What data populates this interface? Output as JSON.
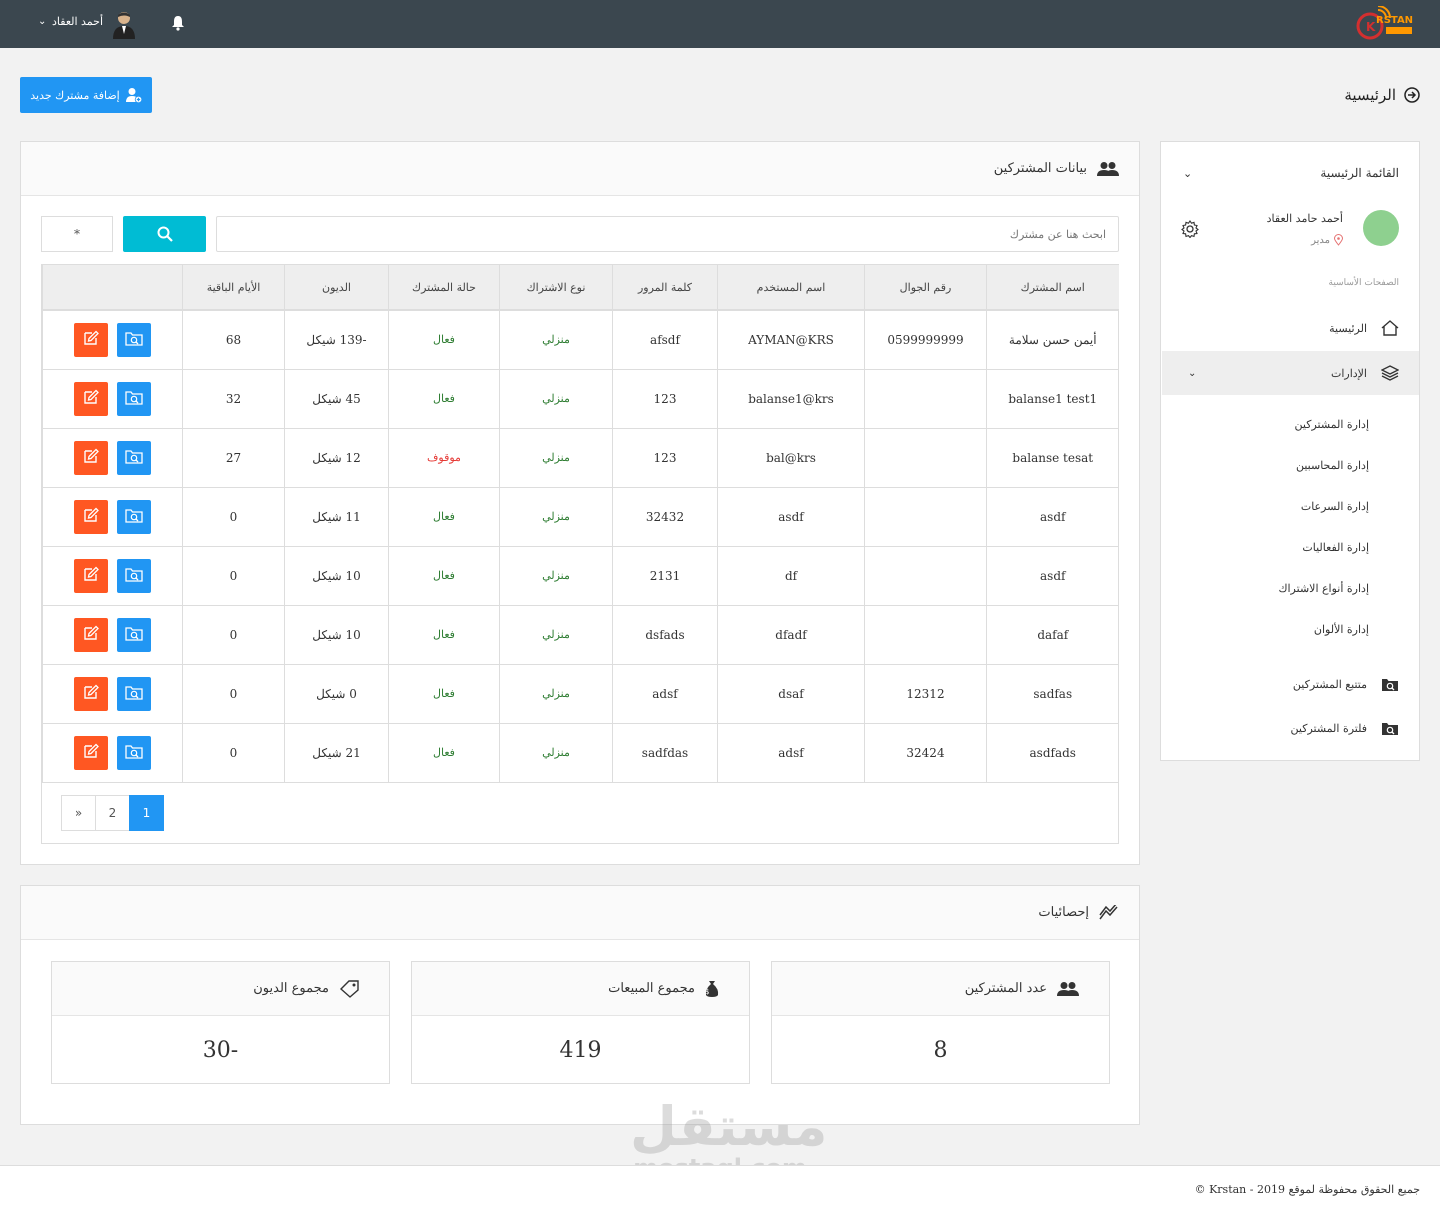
{
  "header": {
    "logo_text": "KRSTAN",
    "user_name": "أحمد العقاد"
  },
  "page": {
    "breadcrumb": "الرئيسية",
    "add_button": "إضافة مشترك جديد"
  },
  "subscribers": {
    "title": "بيانات المشتركين",
    "search_placeholder": "ابحث هنا عن مشترك",
    "star": "*",
    "columns": [
      "اسم المشترك",
      "رقم الجوال",
      "اسم المستخدم",
      "كلمة المرور",
      "نوع الاشتراك",
      "حالة المشترك",
      "الديون",
      "الأيام الباقية",
      ""
    ],
    "rows": [
      {
        "name": "أيمن حسن سلامة",
        "mobile": "0599999999",
        "username": "AYMAN@KRS",
        "password": "afsdf",
        "type": "منزلي",
        "status": "فعال",
        "debt": "-139 شيكل",
        "days": "68"
      },
      {
        "name": "balanse1 test1",
        "mobile": "",
        "username": "balanse1@krs",
        "password": "123",
        "type": "منزلي",
        "status": "فعال",
        "debt": "45 شيكل",
        "days": "32"
      },
      {
        "name": "balanse tesat",
        "mobile": "",
        "username": "bal@krs",
        "password": "123",
        "type": "منزلي",
        "status": "موقوف",
        "debt": "12 شيكل",
        "days": "27"
      },
      {
        "name": "asdf",
        "mobile": "",
        "username": "asdf",
        "password": "32432",
        "type": "منزلي",
        "status": "فعال",
        "debt": "11 شيكل",
        "days": "0"
      },
      {
        "name": "asdf",
        "mobile": "",
        "username": "df",
        "password": "2131",
        "type": "منزلي",
        "status": "فعال",
        "debt": "10 شيكل",
        "days": "0"
      },
      {
        "name": "dafaf",
        "mobile": "",
        "username": "dfadf",
        "password": "dsfads",
        "type": "منزلي",
        "status": "فعال",
        "debt": "10 شيكل",
        "days": "0"
      },
      {
        "name": "sadfas",
        "mobile": "12312",
        "username": "dsaf",
        "password": "adsf",
        "type": "منزلي",
        "status": "فعال",
        "debt": "0 شيكل",
        "days": "0"
      },
      {
        "name": "asdfads",
        "mobile": "32424",
        "username": "adsf",
        "password": "sadfdas",
        "type": "منزلي",
        "status": "فعال",
        "debt": "21 شيكل",
        "days": "0"
      }
    ],
    "pagination": {
      "pages": [
        "1",
        "2"
      ],
      "active": "1",
      "next": "»"
    }
  },
  "stats": {
    "title": "إحصائيات",
    "cards": [
      {
        "label": "عدد المشتركين",
        "value": "8",
        "icon": "users-icon"
      },
      {
        "label": "مجموع المبيعات",
        "value": "419",
        "icon": "money-bag-icon"
      },
      {
        "label": "مجموع الديون",
        "value": "30-",
        "icon": "tag-icon"
      }
    ]
  },
  "sidebar": {
    "title": "القائمة الرئيسية",
    "user_name": "أحمد حامد العقاد",
    "user_role": "مدير",
    "section": "الصفحات الأساسية",
    "home": "الرئيسية",
    "management": "الإدارات",
    "sub_items": [
      "إدارة المشتركين",
      "إدارة المحاسبين",
      "إدارة السرعات",
      "إدارة الفعاليات",
      "إدارة أنواع الاشتراك",
      "إدارة الألوان"
    ],
    "tracking": "متتبع المشتركين",
    "filter": "فلترة المشتركين"
  },
  "footer": {
    "text": "جميع الحقوق محفوظة لموقع 2019 - Krstan ©"
  },
  "watermark": {
    "arabic": "مستقل",
    "latin": "mostaql.com"
  },
  "colors": {
    "topbar": "#3b474f",
    "primary": "#2196f3",
    "search": "#00bcd4",
    "edit": "#ff5722",
    "active": "#2e7d32",
    "stopped": "#e53935"
  }
}
